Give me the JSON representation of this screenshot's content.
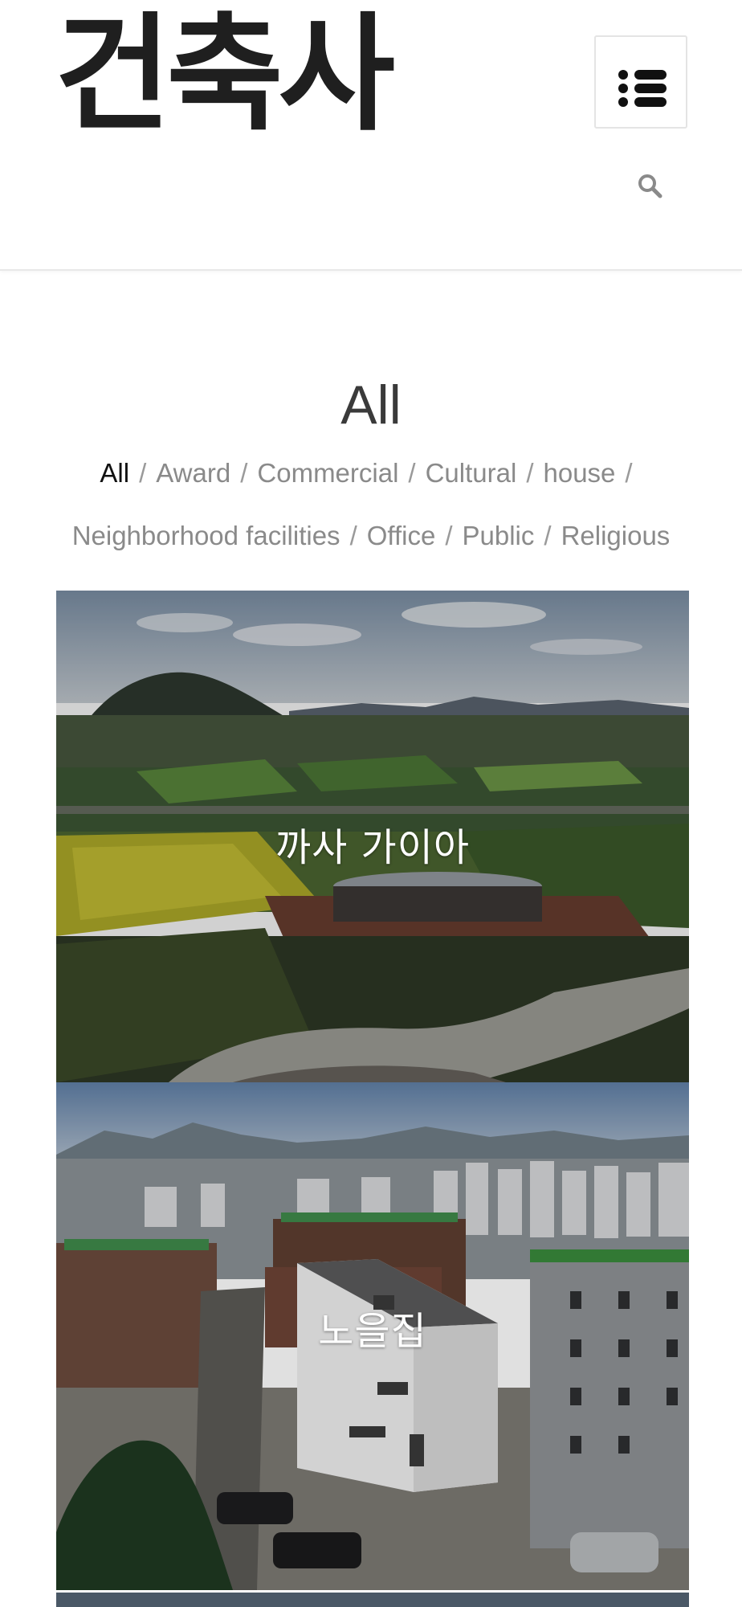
{
  "site": {
    "logo_text": "건축사"
  },
  "header": {
    "menu_icon": "menu-list-icon",
    "search_icon": "search-icon"
  },
  "page": {
    "title": "All"
  },
  "filters": [
    {
      "label": "All",
      "active": true
    },
    {
      "label": "Award"
    },
    {
      "label": "Commercial"
    },
    {
      "label": "Cultural"
    },
    {
      "label": "house"
    },
    {
      "label": "Neighborhood facilities"
    },
    {
      "label": "Office"
    },
    {
      "label": "Public"
    },
    {
      "label": "Religious"
    }
  ],
  "filter_separator": "/",
  "projects": [
    {
      "title": "까사 가이아"
    },
    {
      "title": "노을집"
    }
  ]
}
